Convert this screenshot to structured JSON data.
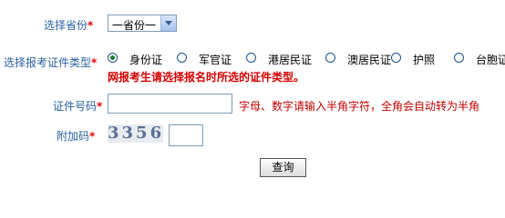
{
  "form": {
    "province": {
      "label": "选择省份",
      "required_mark": "*",
      "selected": "一省份一"
    },
    "cert_type": {
      "label": "选择报考证件类型",
      "required_mark": "*",
      "options": [
        "身份证",
        "军官证",
        "港居民证",
        "澳居民证",
        "护照",
        "台胞证"
      ],
      "selected_index": 0,
      "warning": "网报考生请选择报名时所选的证件类型。"
    },
    "cert_number": {
      "label": "证件号码",
      "required_mark": "*",
      "value": "",
      "hint": "字母、数字请输入半角字符，全角会自动转为半角"
    },
    "captcha": {
      "label": "附加码",
      "required_mark": "*",
      "image_text": "3356",
      "value": ""
    },
    "submit_label": "查询"
  },
  "colors": {
    "label": "#2a62a0",
    "required": "#e30000",
    "warning": "#d60000",
    "hint": "#c00000"
  }
}
